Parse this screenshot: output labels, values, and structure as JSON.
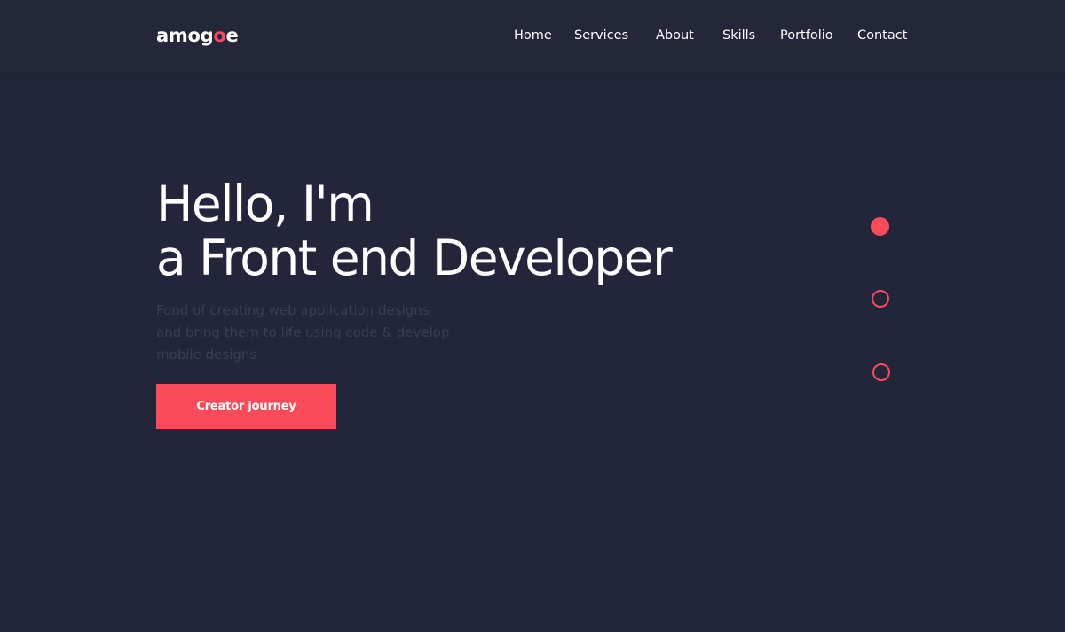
{
  "header": {
    "logo": {
      "part1": "amog",
      "accent": "o",
      "part2": "e"
    },
    "nav": [
      {
        "label": "Home"
      },
      {
        "label": "Services"
      },
      {
        "label": "About"
      },
      {
        "label": "Skills"
      },
      {
        "label": "Portfolio"
      },
      {
        "label": "Contact"
      }
    ]
  },
  "hero": {
    "title_line1": "Hello, I'm",
    "title_line2": "a Front end Developer",
    "desc_line1": "Fond of creating web application designs",
    "desc_line2": "and bring them to life using code & develop",
    "desc_line3": "mobile designs",
    "cta_label": "Creator journey"
  },
  "slider": {
    "slides": 3,
    "active_index": 0
  },
  "colors": {
    "background": "#23253a",
    "accent": "#fb4b5b",
    "text": "#ffffff",
    "muted_text": "#3b3e52"
  }
}
